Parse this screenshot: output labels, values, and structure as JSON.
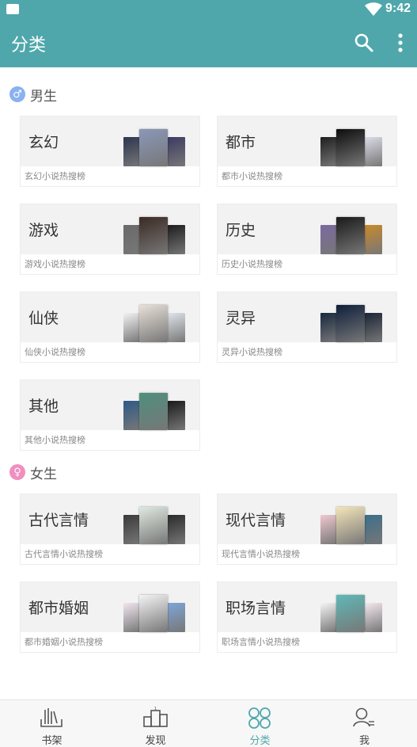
{
  "status": {
    "time": "9:42"
  },
  "app_bar": {
    "title": "分类"
  },
  "male": {
    "title": "男生",
    "badge": "♂",
    "items": [
      {
        "name": "玄幻",
        "sub": "玄幻小说热搜榜",
        "covers": [
          "#2d3550",
          "#8a98b8",
          "#3c3a63"
        ]
      },
      {
        "name": "都市",
        "sub": "都市小说热搜榜",
        "covers": [
          "#1e1e1e",
          "#0d0d0d",
          "#dcdce8"
        ]
      },
      {
        "name": "游戏",
        "sub": "游戏小说热搜榜",
        "covers": [
          "#6a6a6a",
          "#3b2a24",
          "#1c1c1c"
        ]
      },
      {
        "name": "历史",
        "sub": "历史小说热搜榜",
        "covers": [
          "#7b6aa0",
          "#1a1a1a",
          "#c98a2b"
        ]
      },
      {
        "name": "仙侠",
        "sub": "仙侠小说热搜榜",
        "covers": [
          "#f2f2f2",
          "#e8e0d8",
          "#dfe4ea"
        ]
      },
      {
        "name": "灵异",
        "sub": "灵异小说热搜榜",
        "covers": [
          "#18283f",
          "#0e1e3a",
          "#1b2535"
        ]
      },
      {
        "name": "其他",
        "sub": "其他小说热搜榜",
        "covers": [
          "#2e5a86",
          "#4e8f7d",
          "#1a1a1a"
        ]
      }
    ]
  },
  "female": {
    "title": "女生",
    "badge": "♀",
    "items": [
      {
        "name": "古代言情",
        "sub": "古代言情小说热搜榜",
        "covers": [
          "#3a3a3a",
          "#dfe9e0",
          "#2a2a2a"
        ]
      },
      {
        "name": "现代言情",
        "sub": "现代言情小说热搜榜",
        "covers": [
          "#f0c8d0",
          "#f4e5b8",
          "#3a6f8a"
        ]
      },
      {
        "name": "都市婚姻",
        "sub": "都市婚姻小说热搜榜",
        "covers": [
          "#f1e6ee",
          "#f4f4f4",
          "#7fa6d6"
        ]
      },
      {
        "name": "职场言情",
        "sub": "职场言情小说热搜榜",
        "covers": [
          "#f4f4f4",
          "#5fb9b7",
          "#f4e9ef"
        ]
      }
    ]
  },
  "nav": [
    {
      "label": "书架",
      "icon": "bookshelf-icon",
      "active": false
    },
    {
      "label": "发现",
      "icon": "discover-icon",
      "active": false
    },
    {
      "label": "分类",
      "icon": "category-icon",
      "active": true
    },
    {
      "label": "我",
      "icon": "profile-icon",
      "active": false
    }
  ],
  "colors": {
    "accent": "#4fa7ab"
  }
}
